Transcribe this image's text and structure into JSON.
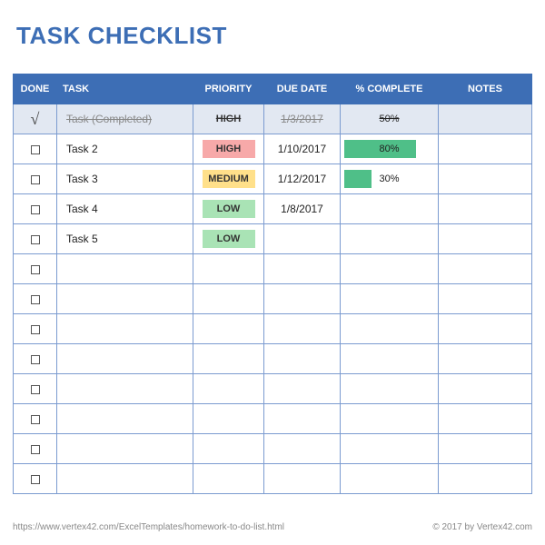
{
  "title": "TASK CHECKLIST",
  "columns": {
    "done": "DONE",
    "task": "TASK",
    "priority": "PRIORITY",
    "due": "DUE DATE",
    "complete": "% COMPLETE",
    "notes": "NOTES"
  },
  "rows": [
    {
      "done": true,
      "task": "Task (Completed)",
      "priority": "HIGH",
      "due": "1/3/2017",
      "complete": 50,
      "notes": ""
    },
    {
      "done": false,
      "task": "Task 2",
      "priority": "HIGH",
      "due": "1/10/2017",
      "complete": 80,
      "notes": ""
    },
    {
      "done": false,
      "task": "Task 3",
      "priority": "MEDIUM",
      "due": "1/12/2017",
      "complete": 30,
      "notes": ""
    },
    {
      "done": false,
      "task": "Task 4",
      "priority": "LOW",
      "due": "1/8/2017",
      "complete": null,
      "notes": ""
    },
    {
      "done": false,
      "task": "Task 5",
      "priority": "LOW",
      "due": "",
      "complete": null,
      "notes": ""
    },
    {
      "done": false,
      "task": "",
      "priority": "",
      "due": "",
      "complete": null,
      "notes": ""
    },
    {
      "done": false,
      "task": "",
      "priority": "",
      "due": "",
      "complete": null,
      "notes": ""
    },
    {
      "done": false,
      "task": "",
      "priority": "",
      "due": "",
      "complete": null,
      "notes": ""
    },
    {
      "done": false,
      "task": "",
      "priority": "",
      "due": "",
      "complete": null,
      "notes": ""
    },
    {
      "done": false,
      "task": "",
      "priority": "",
      "due": "",
      "complete": null,
      "notes": ""
    },
    {
      "done": false,
      "task": "",
      "priority": "",
      "due": "",
      "complete": null,
      "notes": ""
    },
    {
      "done": false,
      "task": "",
      "priority": "",
      "due": "",
      "complete": null,
      "notes": ""
    },
    {
      "done": false,
      "task": "",
      "priority": "",
      "due": "",
      "complete": null,
      "notes": ""
    }
  ],
  "footer": {
    "url": "https://www.vertex42.com/ExcelTemplates/homework-to-do-list.html",
    "copyright": "© 2017 by Vertex42.com"
  },
  "priority_styles": {
    "HIGH": "prio-high",
    "MEDIUM": "prio-medium",
    "LOW": "prio-low"
  }
}
